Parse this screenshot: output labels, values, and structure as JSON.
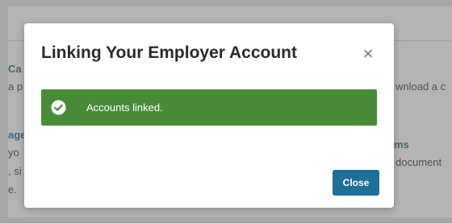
{
  "background": {
    "left_link_1": "Ca",
    "left_text_1": "a p",
    "left_link_2": "age",
    "left_text_2": "yo",
    "left_text_3": ", si",
    "left_text_4": "e.",
    "right_text_1": "wnload a c",
    "right_link_2": "ms",
    "right_text_2": "document"
  },
  "modal": {
    "title": "Linking Your Employer Account",
    "close_icon": "close-icon",
    "alert": {
      "icon": "check-circle-icon",
      "text": "Accounts linked.",
      "color": "#4a8b3a"
    },
    "close_button_label": "Close",
    "close_button_color": "#1f6f97"
  }
}
